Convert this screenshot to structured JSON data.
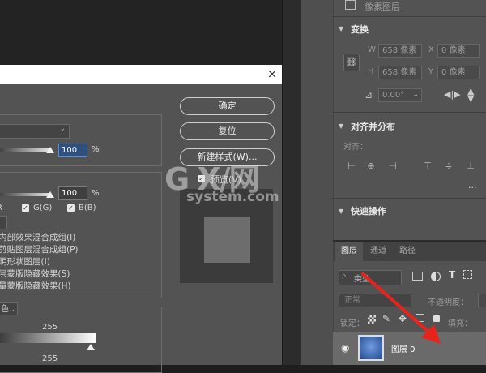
{
  "dialog": {
    "close_glyph": "×",
    "opacity_value": "100",
    "percent": "%",
    "fill_value": "100",
    "percent2": "%",
    "channels": [
      "R",
      "G(G)",
      "B(B)"
    ],
    "options": [
      "内部效果混合成组(I)",
      "剪贴图层混合成组(P)",
      "明形状图层(I)",
      "层蒙版隐藏效果(S)",
      "量蒙版隐藏效果(H)"
    ],
    "blend_dd_label": "色",
    "blend_value_top": "255",
    "blend_value_bottom": "255",
    "buttons": {
      "ok": "确定",
      "reset": "复位",
      "new_style": "新建样式(W)...",
      "preview": "预览(V)"
    }
  },
  "properties": {
    "pixel_layer_label": "像素图层",
    "transform_title": "变换",
    "w_label": "W",
    "w_value": "658 像素",
    "x_label": "X",
    "x_value": "0 像素",
    "h_label": "H",
    "h_value": "658 像素",
    "y_label": "Y",
    "y_value": "0 像素",
    "angle_value": "0.00°",
    "align_title": "对齐并分布",
    "align_label": "对齐：",
    "more": "...",
    "quick_title": "快速操作"
  },
  "layers": {
    "tabs": [
      "图层",
      "通道",
      "路径"
    ],
    "filter_label": "类型",
    "blend_mode": "正常",
    "opacity_label": "不透明度：",
    "lock_label": "锁定：",
    "fill_label": "填充：",
    "layer_name": "图层 0"
  },
  "watermark": {
    "mark": "G X/网",
    "site": "system.com"
  },
  "colors": {
    "panel": "#535353",
    "canvas": "#232323",
    "accent_arrow": "#e8231c",
    "selection": "#2a5fb4"
  }
}
